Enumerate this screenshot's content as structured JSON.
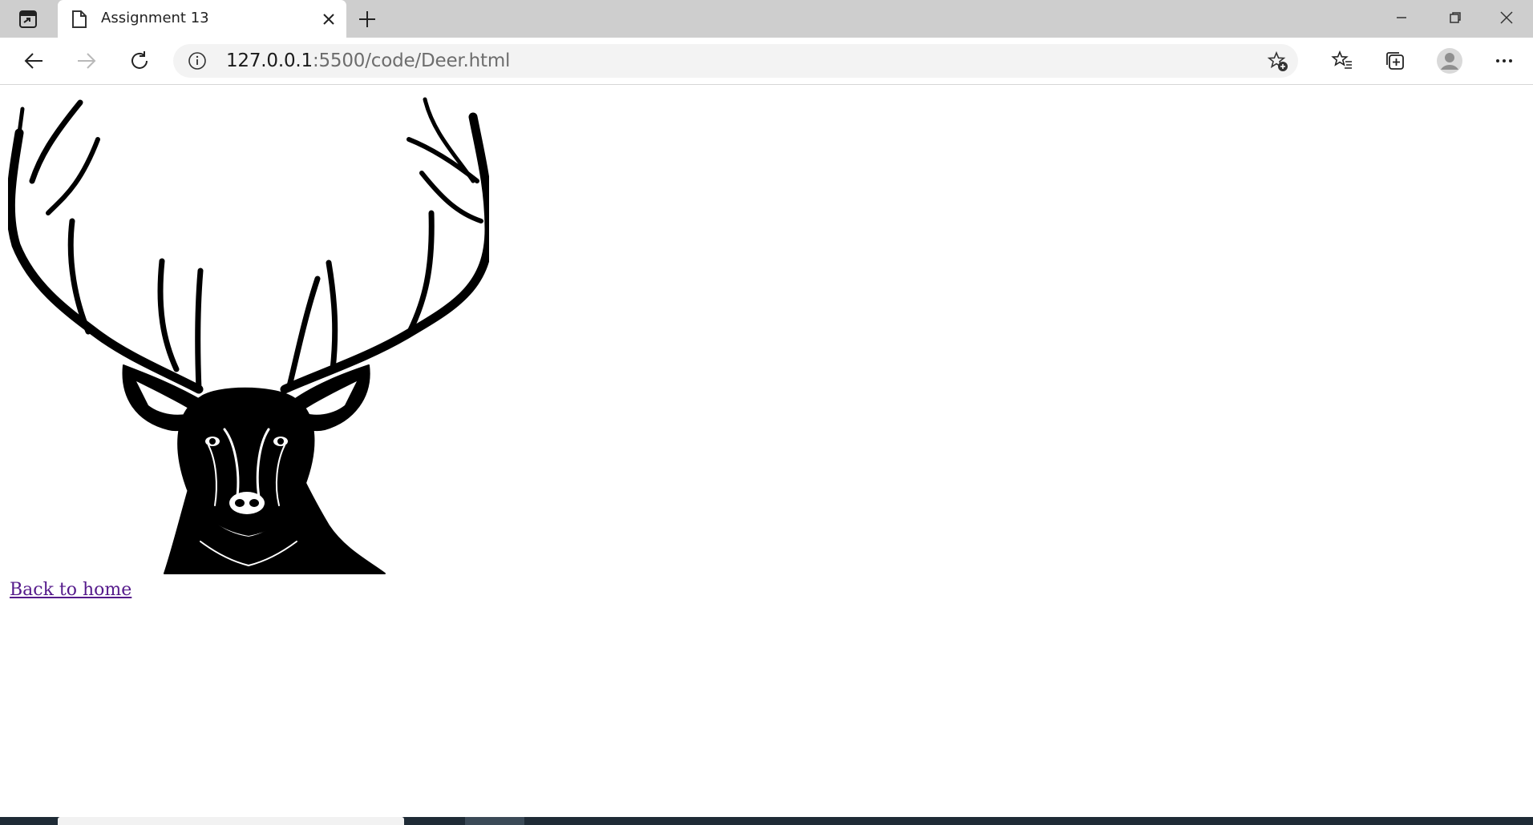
{
  "browser": {
    "tab": {
      "title": "Assignment 13"
    },
    "address": {
      "host": "127.0.0.1",
      "rest": ":5500/code/Deer.html"
    }
  },
  "page": {
    "link_text": "Back to home",
    "link_color": "#551a8b",
    "image": {
      "subject": "deer-head-engraving",
      "color": "#000000"
    }
  },
  "icons": {
    "tab_actions": "tab-actions-icon",
    "favicon": "page-icon",
    "close": "close-icon",
    "new_tab": "plus-icon",
    "back": "back-arrow-icon",
    "forward": "forward-arrow-icon",
    "refresh": "refresh-icon",
    "info": "info-icon",
    "add_favorite": "star-plus-icon",
    "favorites": "favorites-icon",
    "collections": "collections-icon",
    "profile": "profile-avatar-icon",
    "more": "more-icon"
  },
  "colors": {
    "tabbar": "#cecece",
    "toolbar": "#ffffff",
    "address_bg": "#f3f3f3",
    "taskbar": "#1f2b36"
  }
}
